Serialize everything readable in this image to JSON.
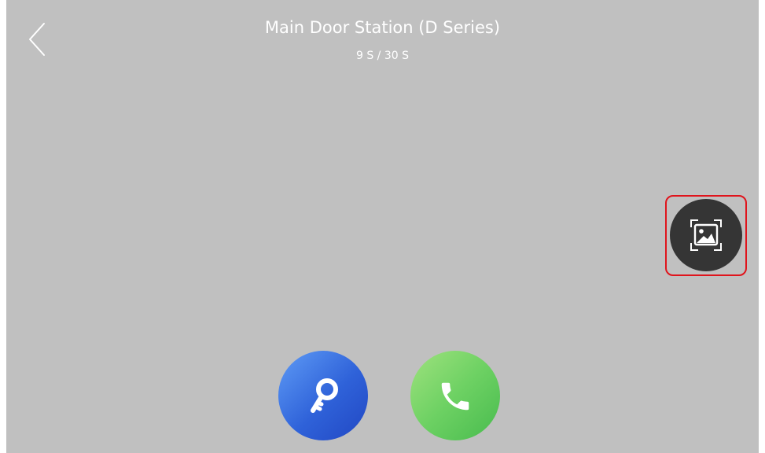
{
  "header": {
    "title": "Main Door Station (D Series)",
    "timer": "9 S / 30 S"
  },
  "icons": {
    "back": "chevron-left-icon",
    "capture": "capture-image-icon",
    "unlock": "key-icon",
    "answer": "phone-icon"
  },
  "colors": {
    "screen_background": "#c0c0c0",
    "capture_button": "#353535",
    "highlight_border": "#e0141c",
    "unlock_button": "#2f62d9",
    "answer_button": "#6dd163",
    "text": "#ffffff"
  }
}
